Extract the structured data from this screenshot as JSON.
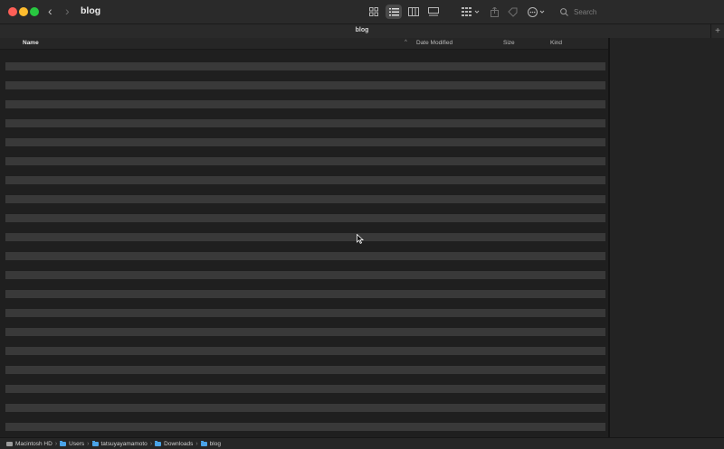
{
  "window": {
    "title": "blog",
    "tab_title": "blog"
  },
  "toolbar": {
    "search_placeholder": "Search",
    "icons": [
      "back-chevron",
      "forward-chevron",
      "icon-view",
      "list-view",
      "column-view",
      "gallery-view",
      "group-by",
      "share",
      "tag",
      "action-more",
      "search"
    ]
  },
  "columns": {
    "name": "Name",
    "date_modified": "Date Modified",
    "size": "Size",
    "kind": "Kind",
    "sort_indicator": "^"
  },
  "pathbar": {
    "items": [
      "Macintosh HD",
      "Users",
      "tatsuyayamamoto",
      "Downloads",
      "blog"
    ],
    "separator": "›"
  },
  "colors": {
    "close": "#fe5f57",
    "minimize": "#febc2e",
    "maximize": "#28c840",
    "folder": "#4aa3e8"
  }
}
